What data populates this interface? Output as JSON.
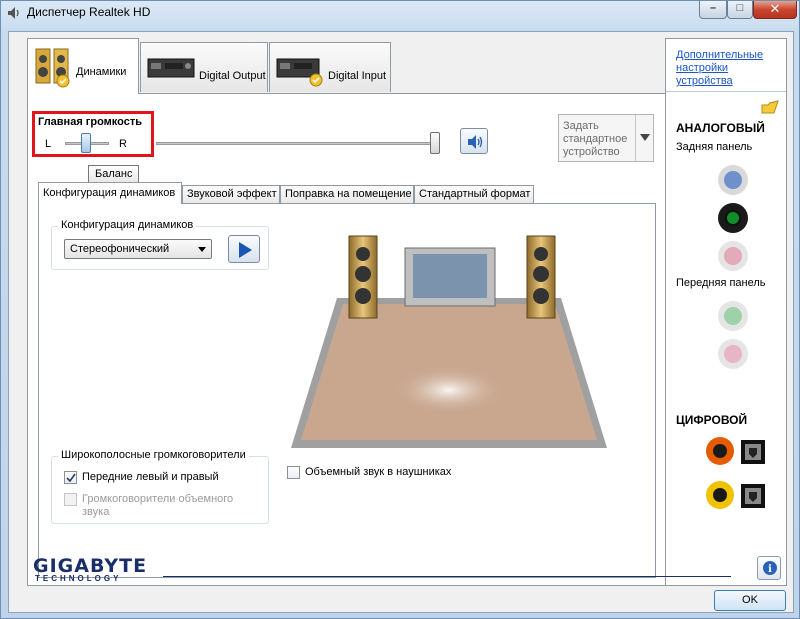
{
  "window": {
    "title": "Диспетчер Realtek HD",
    "minimize": "–",
    "maximize": "□",
    "close": "✕"
  },
  "main_tabs": [
    {
      "label": "Динамики",
      "icon": "speakers-icon",
      "active": true
    },
    {
      "label": "Digital Output",
      "icon": "digital-output-device-icon",
      "active": false
    },
    {
      "label": "Digital Input",
      "icon": "digital-input-device-icon",
      "active": false
    }
  ],
  "volume": {
    "title": "Главная громкость",
    "left_label": "L",
    "right_label": "R",
    "balance_tooltip": "Баланс",
    "balance_level": 0.5,
    "master_level": 1.0,
    "default_device_label": "Задать стандартное устройство"
  },
  "sub_tabs": [
    {
      "label": "Конфигурация динамиков",
      "active": true
    },
    {
      "label": "Звуковой эффект",
      "active": false
    },
    {
      "label": "Поправка на помещение",
      "active": false
    },
    {
      "label": "Стандартный формат",
      "active": false
    }
  ],
  "speaker_config": {
    "group_title": "Конфигурация динамиков",
    "selected": "Стереофонический"
  },
  "fullrange": {
    "group_title": "Широкополосные громкоговорители",
    "front_lr": {
      "label": "Передние левый и правый",
      "checked": true
    },
    "surround": {
      "label": "Громкоговорители объемного звука",
      "checked": false,
      "disabled": true
    }
  },
  "headphone_virtualization": {
    "label": "Объемный звук в наушниках",
    "checked": false
  },
  "side": {
    "advanced_link": "Дополнительные настройки устройства",
    "analog_title": "АНАЛОГОВЫЙ",
    "back_panel": "Задняя панель",
    "front_panel": "Передняя панель",
    "digital_title": "ЦИФРОВОЙ",
    "colors": {
      "blue": "#6f90cc",
      "green": "#0f8f2a",
      "pink": "#e3aab8",
      "green_light": "#9fd1a9",
      "pink_light": "#e8b5c4",
      "orange": "#e65a00",
      "yellow": "#f1c200"
    }
  },
  "footer": {
    "brand": "GIGABYTE",
    "brand_sub": "TECHNOLOGY",
    "ok_label": "OK",
    "info_icon": "i"
  }
}
